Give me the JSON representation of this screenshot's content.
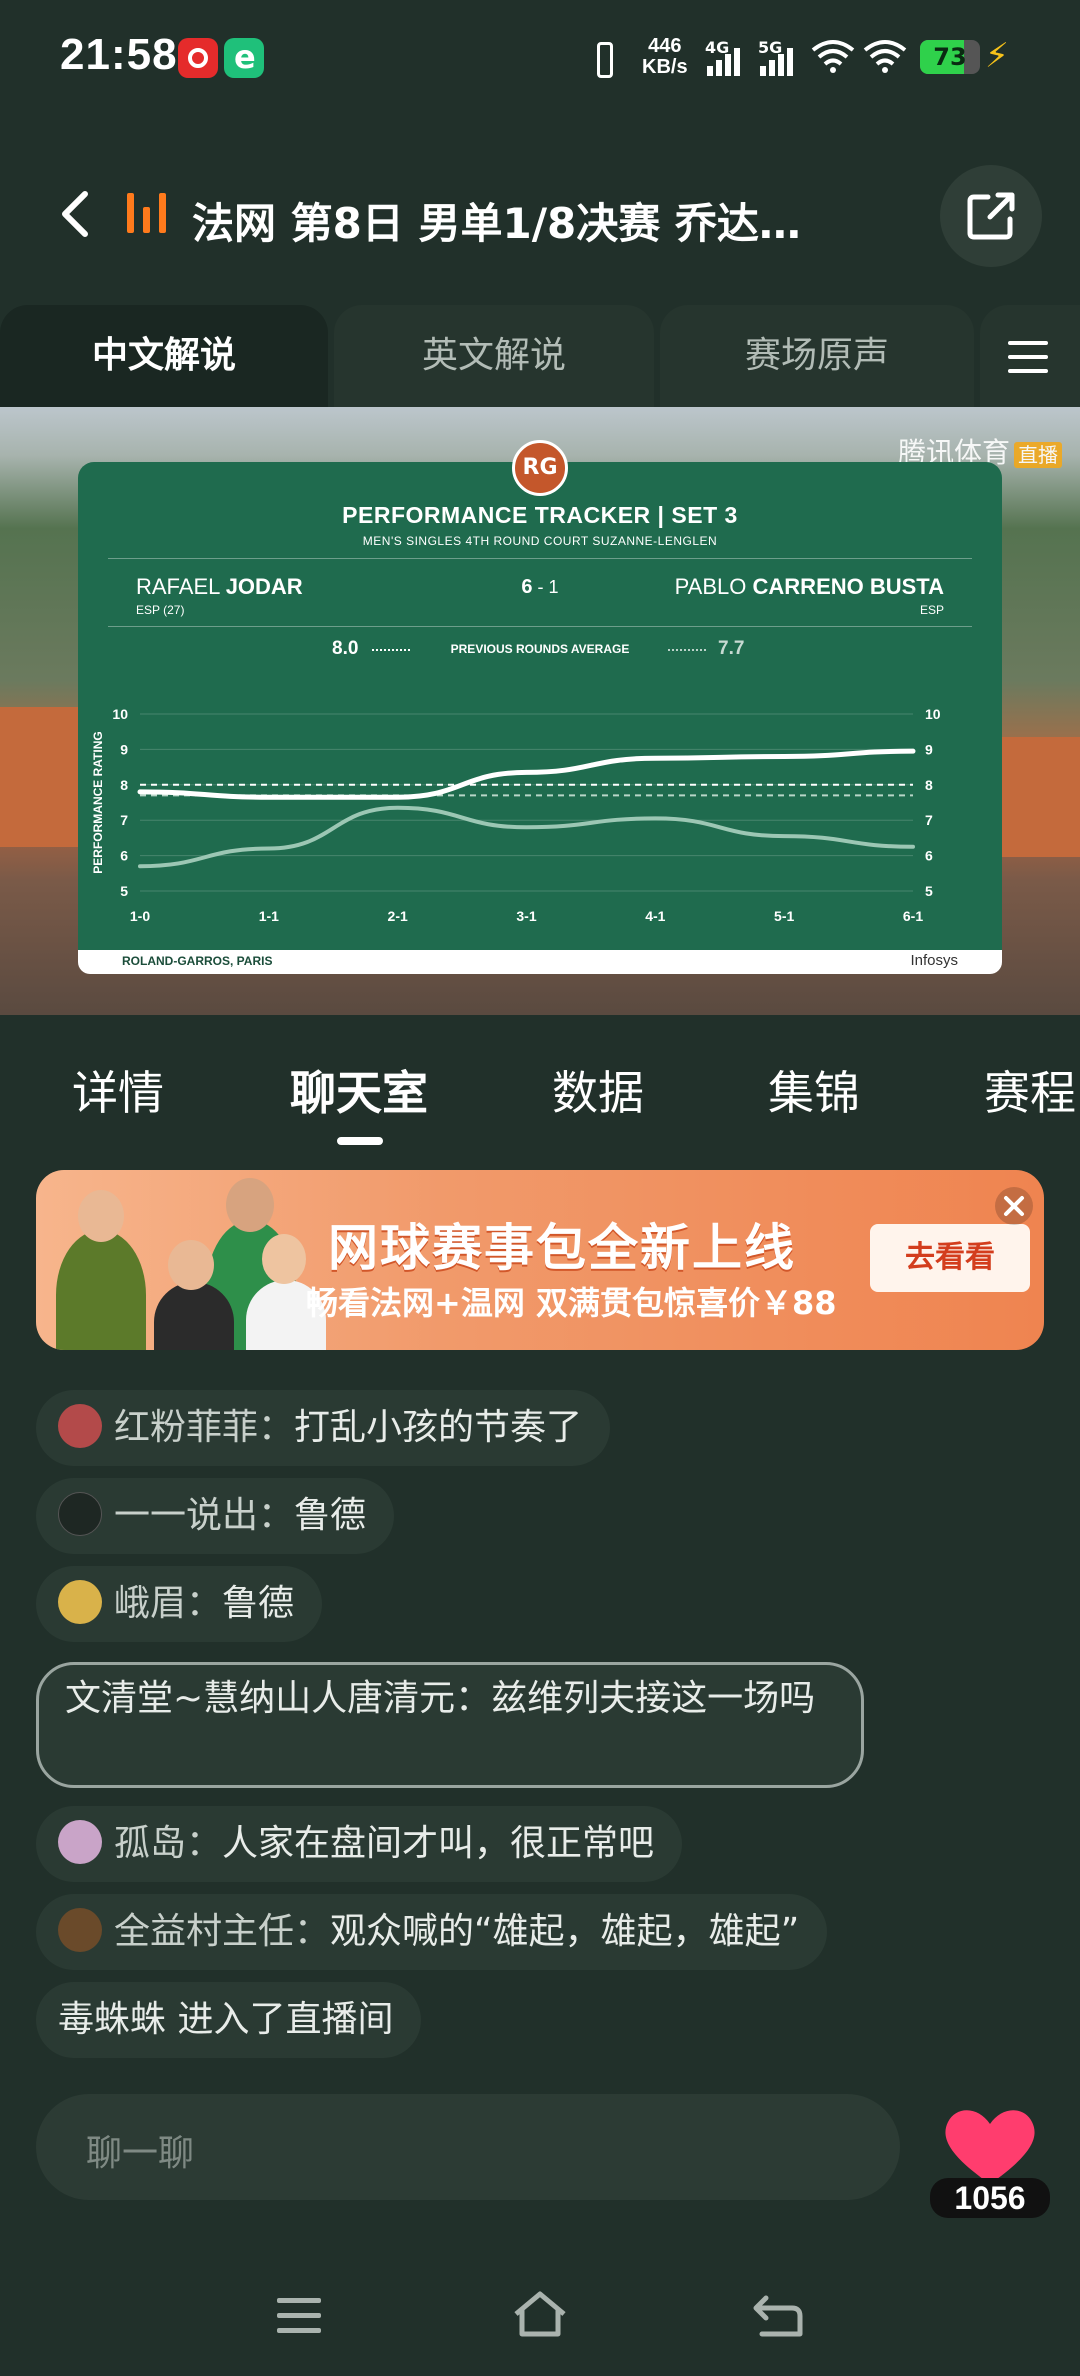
{
  "status_bar": {
    "time": "21:58",
    "net_speed_value": "446",
    "net_speed_unit": "KB/s",
    "sig1_label": "4G",
    "sig2_label": "5G",
    "battery": "73",
    "battery_level": 0.73,
    "colors": {
      "battery": "#2fd14b",
      "charging": "#f6c21a"
    }
  },
  "header": {
    "title": "法网 第8日 男单1/8决赛 乔达…",
    "live_icon": "live-bars-icon",
    "accent": "#ff7a1c"
  },
  "commentary_tabs": [
    {
      "label": "中文解说",
      "active": true
    },
    {
      "label": "英文解说",
      "active": false
    },
    {
      "label": "赛场原声",
      "active": false
    }
  ],
  "video": {
    "watermark": "腾讯体育",
    "watermark_badge": "直播",
    "panel": {
      "logo": "RG",
      "title": "PERFORMANCE TRACKER | SET 3",
      "subtitle": "MEN'S SINGLES 4TH ROUND   COURT SUZANNE-LENGLEN",
      "player1_first": "RAFAEL",
      "player1_last": "JODAR",
      "player1_country": "ESP (27)",
      "player2_first": "PABLO",
      "player2_last": "CARRENO BUSTA",
      "player2_country": "ESP",
      "score_main": "6",
      "score_sep": " - ",
      "score_second": "1",
      "avg1": "8.0",
      "avg2": "7.7",
      "avg_label": "PREVIOUS ROUNDS AVERAGE",
      "footer_left": "ROLAND-GARROS, PARIS",
      "footer_right": "Infosys"
    }
  },
  "chart_data": {
    "type": "line",
    "title": "PERFORMANCE TRACKER | SET 3",
    "ylabel": "PERFORMANCE RATING",
    "xlabel": "",
    "categories": [
      "1-0",
      "1-1",
      "2-1",
      "3-1",
      "4-1",
      "5-1",
      "6-1"
    ],
    "yticks": [
      "5",
      "6",
      "7",
      "8",
      "9",
      "10"
    ],
    "ylim": [
      5,
      10
    ],
    "series": [
      {
        "name": "JODAR",
        "values": [
          7.8,
          7.65,
          7.65,
          8.35,
          8.75,
          8.8,
          8.95
        ],
        "color": "#ffffff"
      },
      {
        "name": "CARRENO BUSTA",
        "values": [
          5.7,
          6.2,
          7.35,
          6.8,
          7.05,
          6.55,
          6.25
        ],
        "color": "#9cc7b4"
      }
    ],
    "reference_lines": [
      {
        "label": "8.0",
        "value": 8.0,
        "style": "dashed",
        "color": "#ffffff"
      },
      {
        "label": "7.7",
        "value": 7.7,
        "style": "dashed",
        "color": "#b9d6c8"
      }
    ],
    "grid": true
  },
  "content_tabs": [
    {
      "label": "详情",
      "active": false
    },
    {
      "label": "聊天室",
      "active": true
    },
    {
      "label": "数据",
      "active": false
    },
    {
      "label": "集锦",
      "active": false
    },
    {
      "label": "赛程",
      "active": false
    }
  ],
  "banner": {
    "title": "网球赛事包全新上线",
    "subtitle": "畅看法网+温网 双满贯包惊喜价￥88",
    "button": "去看看"
  },
  "chat": [
    {
      "name": "红粉菲菲：",
      "text": "打乱小孩的节奏了",
      "avatar_color": "#b34a4a"
    },
    {
      "name": "一一说出：",
      "text": "鲁德",
      "avatar_color": "#222b26"
    },
    {
      "name": "峨眉：",
      "text": "鲁德",
      "avatar_color": "#d9b24a"
    },
    {
      "name": "文清堂~慧纳山人唐清元：",
      "text": "兹维列夫接这一场吗",
      "avatar_color": ""
    },
    {
      "name": "孤岛：",
      "text": "人家在盘间才叫，很正常吧",
      "avatar_color": "#c9a4c8"
    },
    {
      "name": "全益村主任：",
      "text": "观众喊的“雄起，雄起，雄起”",
      "avatar_color": "#6a4a2a"
    },
    {
      "name": "毒蛛蛛",
      "text": " 进入了直播间",
      "avatar_color": ""
    }
  ],
  "input": {
    "placeholder": "聊一聊"
  },
  "like": {
    "count": "1056",
    "color": "#ff3d6e"
  }
}
